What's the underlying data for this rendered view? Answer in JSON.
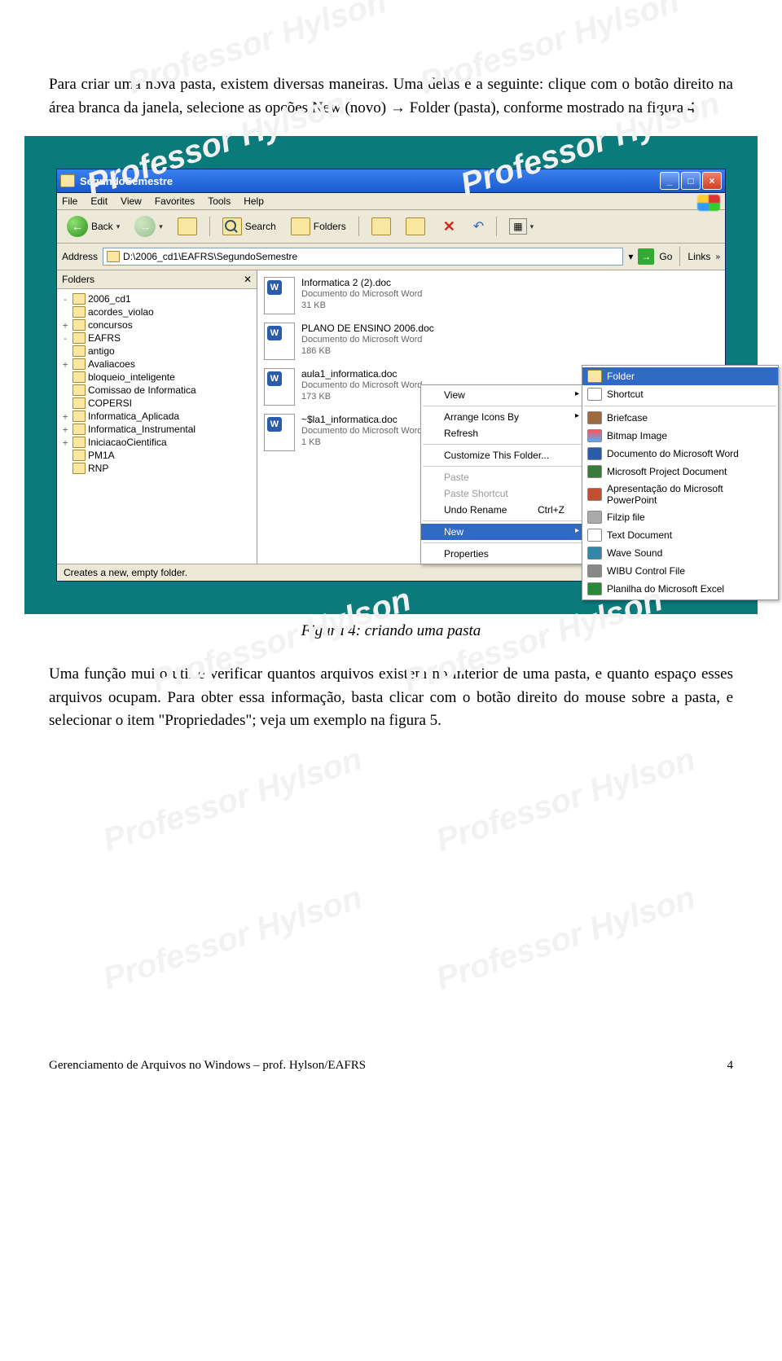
{
  "para1_a": "Para criar uma nova pasta, existem diversas maneiras. Uma delas é a seguinte: clique com o botão direito na área branca da janela, selecione as opções New (novo) ",
  "para1_arrow": "→",
  "para1_b": " Folder (pasta), conforme mostrado na figura 4.",
  "caption": "Figura 4: criando uma pasta",
  "para2": "Uma função muito útil é verificar quantos arquivos existem no interior de uma pasta, e quanto espaço esses arquivos ocupam. Para obter essa informação, basta clicar com o botão direito do mouse sobre a pasta, e selecionar o item \"Propriedades\"; veja um exemplo na figura 5.",
  "watermark": "Professor Hylson",
  "footer_left": "Gerenciamento de Arquivos no Windows – prof. Hylson/EAFRS",
  "footer_right": "4",
  "win": {
    "title": "SegundoSemestre",
    "menu": [
      "File",
      "Edit",
      "View",
      "Favorites",
      "Tools",
      "Help"
    ],
    "toolbar": {
      "back": "Back",
      "search": "Search",
      "folders": "Folders"
    },
    "address_label": "Address",
    "address_value": "D:\\2006_cd1\\EAFRS\\SegundoSemestre",
    "go": "Go",
    "links": "Links",
    "folders_title": "Folders",
    "status": "Creates a new, empty folder.",
    "tree": [
      {
        "lvl": 0,
        "exp": "-",
        "label": "2006_cd1"
      },
      {
        "lvl": 1,
        "exp": "",
        "label": "acordes_violao"
      },
      {
        "lvl": 1,
        "exp": "+",
        "label": "concursos"
      },
      {
        "lvl": 1,
        "exp": "-",
        "label": "EAFRS"
      },
      {
        "lvl": 2,
        "exp": "",
        "label": "antigo"
      },
      {
        "lvl": 2,
        "exp": "+",
        "label": "Avaliacoes"
      },
      {
        "lvl": 2,
        "exp": "",
        "label": "bloqueio_inteligente"
      },
      {
        "lvl": 2,
        "exp": "",
        "label": "Comissao de Informatica"
      },
      {
        "lvl": 2,
        "exp": "",
        "label": "COPERSI"
      },
      {
        "lvl": 2,
        "exp": "+",
        "label": "Informatica_Aplicada"
      },
      {
        "lvl": 2,
        "exp": "+",
        "label": "Informatica_Instrumental"
      },
      {
        "lvl": 2,
        "exp": "+",
        "label": "IniciacaoCientifica"
      },
      {
        "lvl": 2,
        "exp": "",
        "label": "PM1A"
      },
      {
        "lvl": 2,
        "exp": "",
        "label": "RNP"
      }
    ],
    "files": [
      {
        "name": "Informatica 2 (2).doc",
        "type": "Documento do Microsoft Word",
        "size": "31 KB"
      },
      {
        "name": "PLANO DE ENSINO 2006.doc",
        "type": "Documento do Microsoft Word",
        "size": "186 KB"
      },
      {
        "name": "aula1_informatica.doc",
        "type": "Documento do Microsoft Word",
        "size": "173 KB"
      },
      {
        "name": "~$la1_informatica.doc",
        "type": "Documento do Microsoft Word",
        "size": "1 KB"
      }
    ],
    "ctx": {
      "view": "View",
      "arrange": "Arrange Icons By",
      "refresh": "Refresh",
      "customize": "Customize This Folder...",
      "paste": "Paste",
      "paste_sc": "Paste Shortcut",
      "undo": "Undo Rename",
      "undo_key": "Ctrl+Z",
      "new": "New",
      "props": "Properties"
    },
    "sub": [
      {
        "cls": "folder",
        "label": "Folder",
        "sel": true
      },
      {
        "cls": "sc",
        "label": "Shortcut"
      },
      {
        "cls": "brief",
        "label": "Briefcase"
      },
      {
        "cls": "bmp",
        "label": "Bitmap Image"
      },
      {
        "cls": "w",
        "label": "Documento do Microsoft Word"
      },
      {
        "cls": "pj",
        "label": "Microsoft Project Document"
      },
      {
        "cls": "pp",
        "label": "Apresentação do Microsoft PowerPoint"
      },
      {
        "cls": "zip",
        "label": "Filzip file"
      },
      {
        "cls": "sc",
        "label": "Text Document"
      },
      {
        "cls": "wav",
        "label": "Wave Sound"
      },
      {
        "cls": "wibu",
        "label": "WIBU Control File"
      },
      {
        "cls": "xl",
        "label": "Planilha do Microsoft Excel"
      }
    ]
  }
}
